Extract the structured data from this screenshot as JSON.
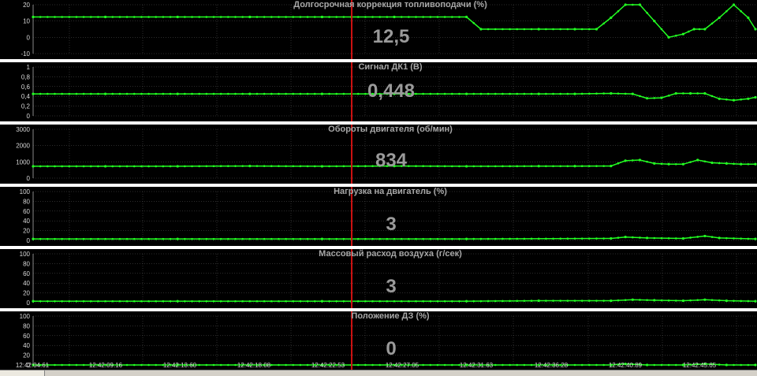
{
  "window": {
    "title": ""
  },
  "colors": {
    "background": "#000000",
    "trace": "#22ff22",
    "grid": "#5a5a5a",
    "cursor": "#cc1111",
    "separator": "#ffffff",
    "title": "#a8a8a8",
    "value": "#9a9a9a",
    "tick": "#d8d8d8"
  },
  "cursor": {
    "time_index": 4.24
  },
  "x_axis": {
    "labels": [
      "12:42:04.61",
      "12:42:09.16",
      "12:42:13.60",
      "12:42:18.08",
      "12:42:22.53",
      "12:42:27.05",
      "12:42:31.63",
      "12:42:36.28",
      "12:42:40.89",
      "12:42:45.65"
    ]
  },
  "panels": [
    {
      "title": "Долгосрочная коррекция топливоподачи  (%)",
      "value": "12,5",
      "y_ticks": [
        "20",
        "10",
        "0",
        "-10"
      ],
      "ylim": [
        -10,
        20
      ]
    },
    {
      "title": "Сигнал ДК1  (В)",
      "value": "0,448",
      "y_ticks": [
        "1",
        "0,8",
        "0,6",
        "0,4",
        "0,2",
        "0"
      ],
      "ylim": [
        0,
        1
      ]
    },
    {
      "title": "Обороты двигателя   (об/мин)",
      "value": "834",
      "y_ticks": [
        "3000",
        "2000",
        "1000",
        "0"
      ],
      "ylim": [
        0,
        3500
      ]
    },
    {
      "title": "Нагрузка на двигатель  (%)",
      "value": "3",
      "y_ticks": [
        "100",
        "80",
        "60",
        "40",
        "20",
        "0"
      ],
      "ylim": [
        0,
        100
      ]
    },
    {
      "title": "Массовый расход воздуха  (г/сек)",
      "value": "3",
      "y_ticks": [
        "100",
        "80",
        "60",
        "40",
        "20",
        "0"
      ],
      "ylim": [
        0,
        100
      ]
    },
    {
      "title": "Положение ДЗ  (%)",
      "value": "0",
      "y_ticks": [
        "100",
        "80",
        "60",
        "40",
        "20",
        "0"
      ],
      "ylim": [
        0,
        100
      ]
    }
  ],
  "chart_data": [
    {
      "type": "line",
      "title": "Долгосрочная коррекция топливоподачи  (%)",
      "ylim": [
        -10,
        20
      ],
      "x": [
        0,
        1,
        2,
        3,
        4,
        5,
        6,
        6.2,
        7,
        7.5,
        7.8,
        8,
        8.2,
        8.4,
        8.6,
        8.8,
        9,
        9.15,
        9.3,
        9.5,
        9.7,
        9.9,
        10
      ],
      "values": [
        12.5,
        12.5,
        12.5,
        12.5,
        12.5,
        12.5,
        12.5,
        5,
        5,
        5,
        5,
        12,
        20,
        20,
        10,
        0,
        2,
        5,
        5,
        12,
        20,
        12,
        5
      ]
    },
    {
      "type": "line",
      "title": "Сигнал ДК1  (В)",
      "ylim": [
        0,
        1
      ],
      "x": [
        0,
        1,
        2,
        3,
        4,
        5,
        6,
        7,
        7.5,
        8,
        8.3,
        8.5,
        8.7,
        8.9,
        9.1,
        9.3,
        9.5,
        9.7,
        9.9,
        10
      ],
      "values": [
        0.45,
        0.45,
        0.45,
        0.45,
        0.45,
        0.45,
        0.45,
        0.45,
        0.45,
        0.46,
        0.45,
        0.36,
        0.37,
        0.46,
        0.46,
        0.46,
        0.35,
        0.32,
        0.35,
        0.38
      ]
    },
    {
      "type": "line",
      "title": "Обороты двигателя   (об/мин)",
      "ylim": [
        0,
        3500
      ],
      "x": [
        0,
        1,
        2,
        3,
        4,
        5,
        6,
        7,
        7.5,
        8,
        8.2,
        8.4,
        8.6,
        8.8,
        9,
        9.2,
        9.4,
        9.6,
        9.8,
        10
      ],
      "values": [
        850,
        850,
        850,
        870,
        850,
        870,
        850,
        860,
        860,
        870,
        1250,
        1300,
        1050,
        1000,
        1000,
        1300,
        1100,
        1050,
        1000,
        1000
      ]
    },
    {
      "type": "line",
      "title": "Нагрузка на двигатель  (%)",
      "ylim": [
        0,
        100
      ],
      "x": [
        0,
        2,
        4,
        6,
        8,
        8.2,
        8.5,
        9,
        9.3,
        9.5,
        10
      ],
      "values": [
        3,
        3,
        3,
        3,
        4,
        7,
        5,
        4,
        9,
        5,
        3
      ]
    },
    {
      "type": "line",
      "title": "Массовый расход воздуха  (г/сек)",
      "ylim": [
        0,
        100
      ],
      "x": [
        0,
        2,
        4,
        6,
        7,
        8,
        8.3,
        8.6,
        9,
        9.3,
        9.6,
        10
      ],
      "values": [
        3,
        3,
        3,
        3,
        4,
        4,
        6,
        5,
        4,
        6,
        4,
        3
      ]
    },
    {
      "type": "line",
      "title": "Положение ДЗ  (%)",
      "ylim": [
        0,
        100
      ],
      "x": [
        0,
        2,
        4,
        6,
        8,
        8.2,
        8.5,
        9,
        9.3,
        9.6,
        10
      ],
      "values": [
        0,
        0,
        0,
        0,
        0,
        2,
        0,
        0,
        2,
        0,
        0
      ]
    }
  ]
}
